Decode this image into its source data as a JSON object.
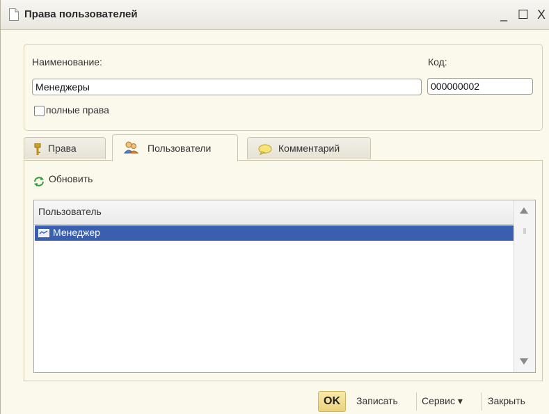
{
  "window": {
    "title": "Права пользователей",
    "minimize_glyph": "_",
    "maximize_glyph": "☐",
    "close_glyph": "X"
  },
  "header": {
    "name_label": "Наименование:",
    "name_value": "Менеджеры",
    "code_label": "Код:",
    "code_value": "000000002",
    "full_rights_label": "полные права",
    "full_rights_checked": false
  },
  "tabs": [
    {
      "label": "Права",
      "icon": "key-icon",
      "active": false
    },
    {
      "label": "Пользователи",
      "icon": "users-icon",
      "active": true
    },
    {
      "label": "Комментарий",
      "icon": "comment-bubble-icon",
      "active": false
    }
  ],
  "users_tab": {
    "refresh_label": "Обновить",
    "table": {
      "columns": [
        "Пользователь"
      ],
      "rows": [
        {
          "user": "Менеджер",
          "selected": true
        }
      ]
    }
  },
  "footer": {
    "ok_label": "OK",
    "save_label": "Записать",
    "service_label": "Сервис ▾",
    "close_label": "Закрыть"
  },
  "colors": {
    "window_bg": "#fbf8ec",
    "selection": "#3b5fb0",
    "ok_button": "#edd27c"
  }
}
